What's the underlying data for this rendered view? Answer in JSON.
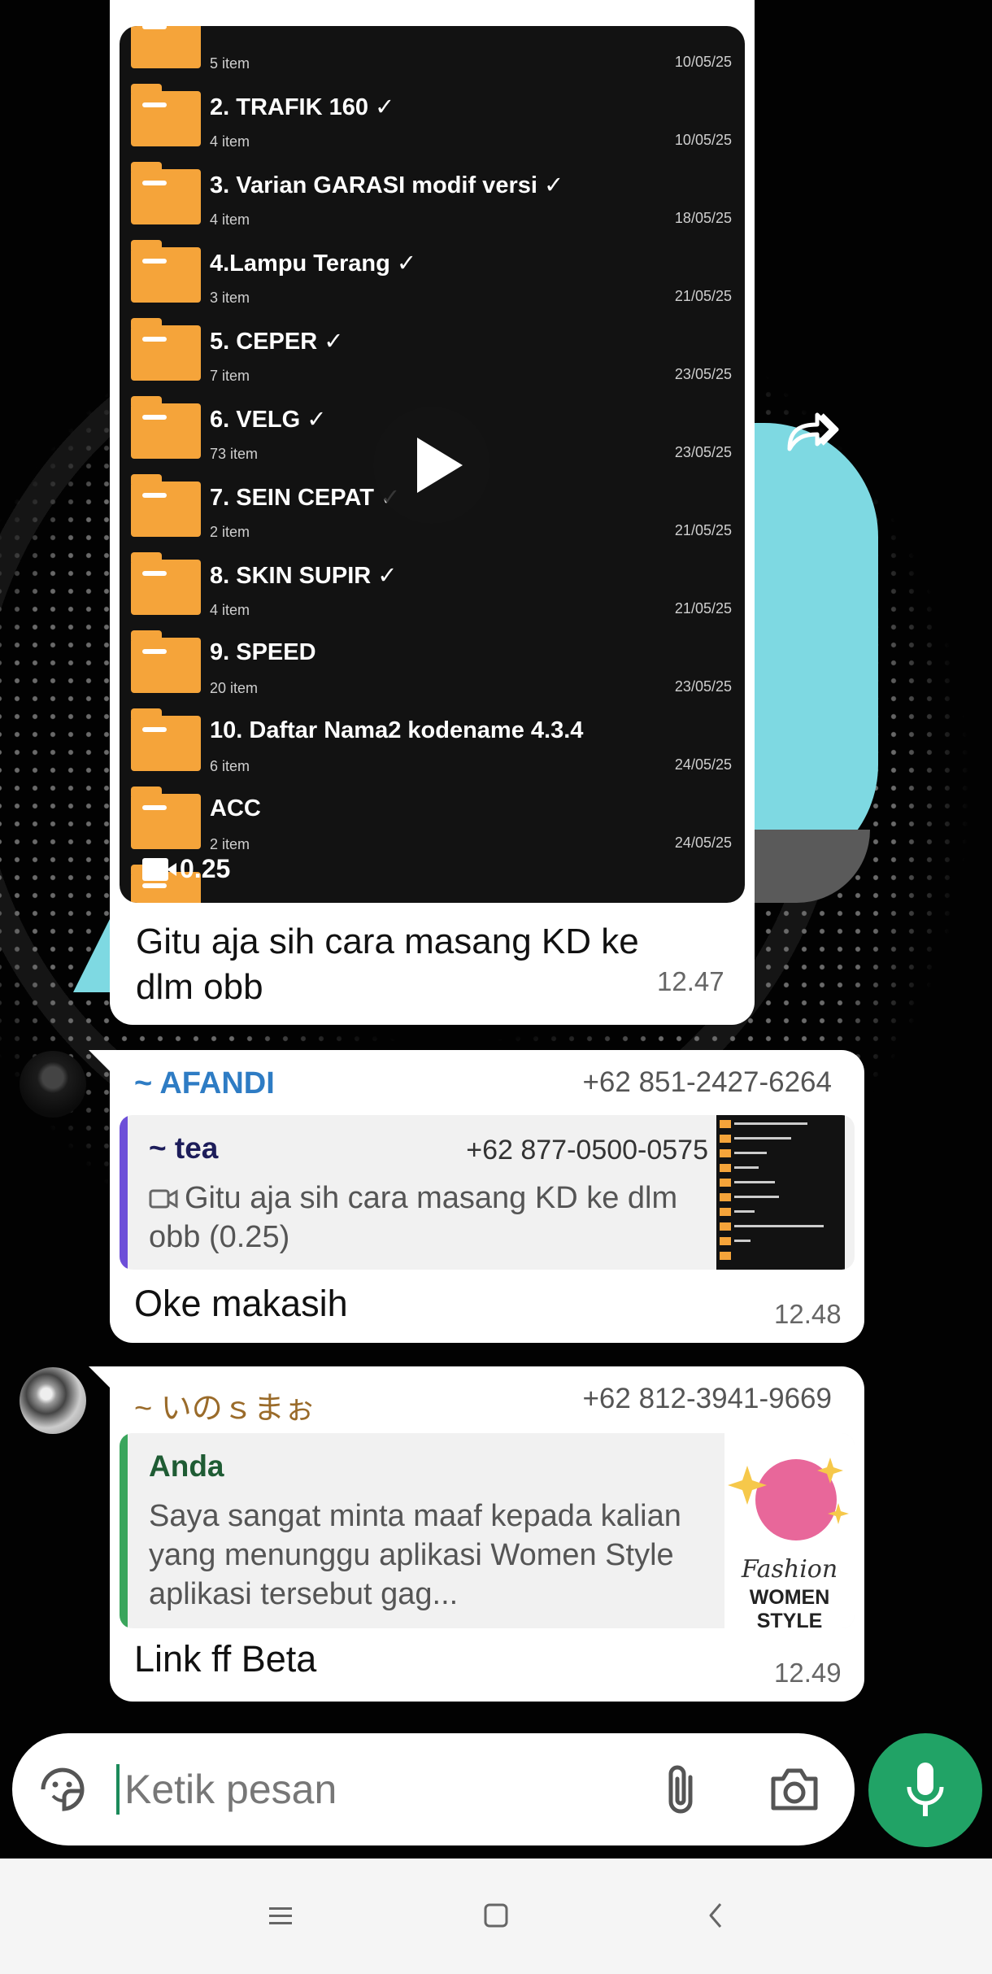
{
  "video_message": {
    "folders": [
      {
        "name": "",
        "count": "5 item",
        "date": "10/05/25"
      },
      {
        "name": "2. TRAFIK 160 ✓",
        "count": "4 item",
        "date": "10/05/25"
      },
      {
        "name": "3. Varian GARASI modif versi ✓",
        "count": "4 item",
        "date": "18/05/25"
      },
      {
        "name": "4.Lampu Terang ✓",
        "count": "3 item",
        "date": "21/05/25"
      },
      {
        "name": "5. CEPER ✓",
        "count": "7 item",
        "date": "23/05/25"
      },
      {
        "name": "6. VELG ✓",
        "count": "73 item",
        "date": "23/05/25"
      },
      {
        "name": "7. SEIN CEPAT ✓",
        "count": "2 item",
        "date": "21/05/25"
      },
      {
        "name": "8. SKIN SUPIR ✓",
        "count": "4 item",
        "date": "21/05/25"
      },
      {
        "name": "9. SPEED",
        "count": "20 item",
        "date": "23/05/25"
      },
      {
        "name": "10. Daftar Nama2 kodename 4.3.4",
        "count": "6 item",
        "date": "24/05/25"
      },
      {
        "name": "ACC",
        "count": "2 item",
        "date": "24/05/25"
      }
    ],
    "duration": "0.25",
    "caption": "Gitu aja sih cara masang KD ke dlm obb",
    "time": "12.47"
  },
  "messages": [
    {
      "sender": "~ AFANDI",
      "sender_color": "#2e7cc4",
      "phone": "+62 851-2427-6264",
      "quote_name": "~ tea",
      "quote_name_color": "#1d1d5a",
      "quote_phone": "+62 877-0500-0575",
      "quote_text": "Gitu aja sih cara masang KD ke dlm obb (0.25)",
      "quote_bar_color": "#6d4fd8",
      "text": "Oke makasih",
      "time": "12.48"
    },
    {
      "sender": "~ いのｓまぉ",
      "sender_color": "#9a6b2a",
      "phone": "+62 812-3941-9669",
      "quote_name": "Anda",
      "quote_name_color": "#1f5c34",
      "quote_text": "Saya sangat minta maaf kepada kalian yang menunggu aplikasi Women Style aplikasi tersebut gag...",
      "quote_bar_color": "#3aa55c",
      "thumb_text_1": "Fashion",
      "thumb_text_2": "WOMEN STYLE",
      "text": "Link ff Beta",
      "time": "12.49"
    }
  ],
  "input": {
    "placeholder": "Ketik pesan"
  },
  "icons": {
    "emoji": "sticker-icon",
    "attach": "paperclip-icon",
    "camera": "camera-icon",
    "mic": "mic-icon",
    "forward": "forward-icon"
  },
  "colors": {
    "accent": "#21a366"
  }
}
